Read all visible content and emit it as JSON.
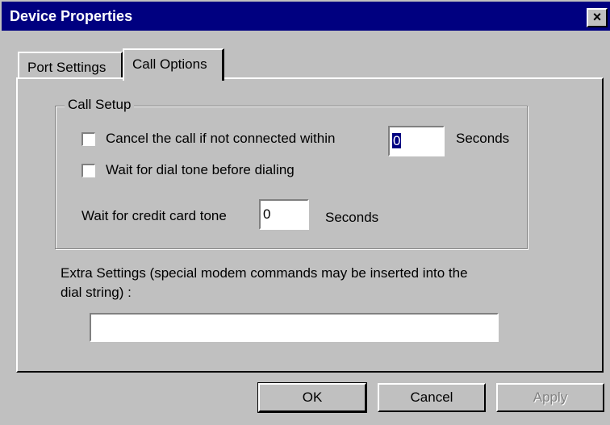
{
  "window": {
    "title": "Device Properties",
    "close_label": "×"
  },
  "tabs": [
    {
      "label": "Port Settings"
    },
    {
      "label": "Call Options"
    }
  ],
  "call_setup": {
    "group_label": "Call Setup",
    "cancel_call_label": "Cancel the call if not connected within",
    "cancel_call_checked": false,
    "cancel_seconds_value": "0",
    "cancel_seconds_unit": "Seconds",
    "wait_dial_tone_label": "Wait for dial tone before dialing",
    "wait_dial_tone_checked": false,
    "credit_card_label": "Wait for credit card tone",
    "credit_card_value": "0",
    "credit_card_unit": "Seconds"
  },
  "extra": {
    "label_line1": "Extra Settings (special modem commands may be inserted into the",
    "label_line2": "dial string) :",
    "value": ""
  },
  "buttons": {
    "ok": "OK",
    "cancel": "Cancel",
    "apply": "Apply"
  },
  "colors": {
    "titlebar": "#000080",
    "face": "#c0c0c0"
  }
}
